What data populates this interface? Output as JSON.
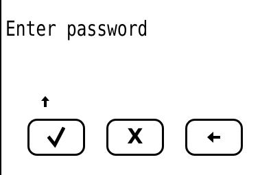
{
  "screen": {
    "prompt": "Enter password"
  },
  "keys": {
    "confirm": {
      "icon": "checkmark-icon"
    },
    "clear": {
      "label": "X"
    },
    "back": {
      "icon": "arrow-left-icon"
    }
  },
  "cursor": {
    "icon": "arrow-up-icon"
  },
  "colors": {
    "background": "#ffffff",
    "foreground": "#000000"
  }
}
